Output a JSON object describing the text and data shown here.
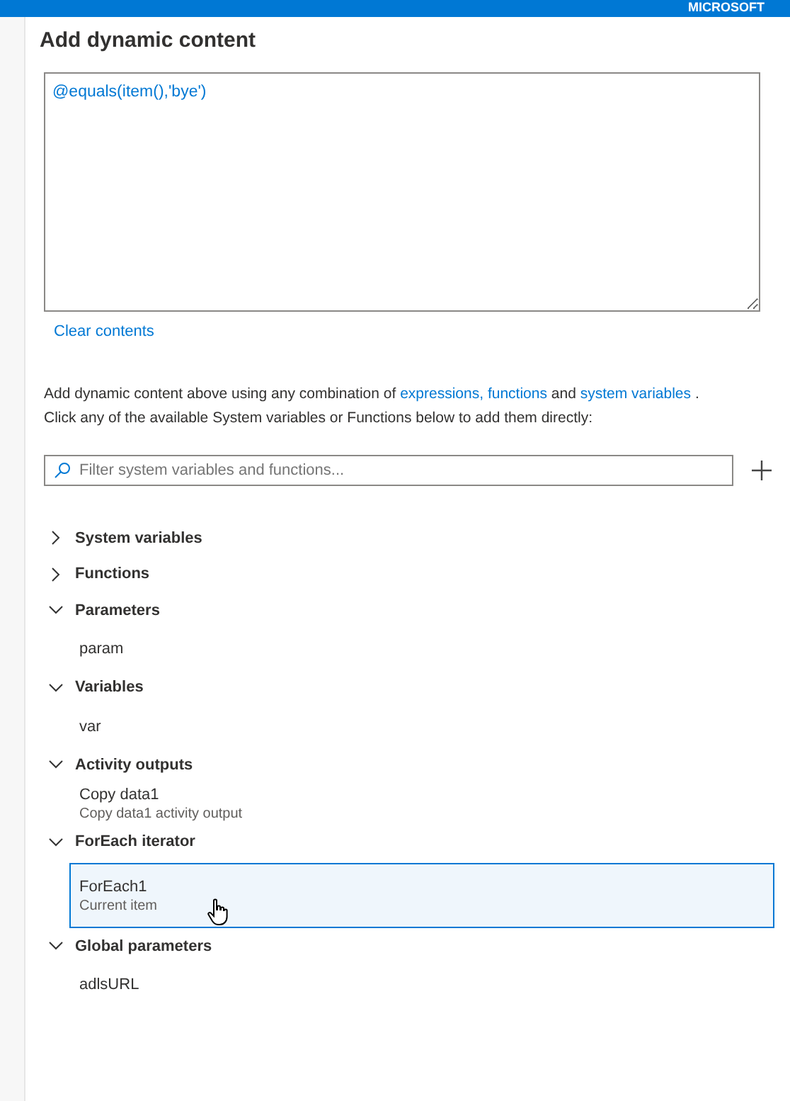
{
  "top_bar": {
    "account": "MICROSOFT"
  },
  "panel": {
    "title": "Add dynamic content",
    "expression": "@equals(item(),'bye')",
    "clear_link": "Clear contents",
    "description": {
      "intro": "Add dynamic content above using any combination of",
      "link_1": "expressions, functions",
      "joiner": "and",
      "link_2": "system variables",
      "end": ".",
      "line_2": "Click any of the available System variables or Functions below to add them directly:"
    },
    "filter": {
      "placeholder": "Filter system variables and functions..."
    },
    "groups": [
      {
        "label": "System variables",
        "expanded": false
      },
      {
        "label": "Functions",
        "expanded": false
      },
      {
        "label": "Parameters",
        "expanded": true,
        "children": [
          {
            "name": "param",
            "selected": false
          }
        ]
      },
      {
        "label": "Variables",
        "expanded": true,
        "children": [
          {
            "name": "var",
            "selected": false
          }
        ]
      },
      {
        "label": "Activity outputs",
        "expanded": true,
        "children": [
          {
            "name": "Copy data1",
            "subtitle": "Copy data1 activity output",
            "selected": false
          }
        ]
      },
      {
        "label": "ForEach iterator",
        "expanded": true,
        "children": [
          {
            "name": "ForEach1",
            "subtitle": "Current item",
            "selected": true
          }
        ]
      },
      {
        "label": "Global parameters",
        "expanded": true,
        "children": [
          {
            "name": "adlsURL",
            "selected": false
          }
        ]
      }
    ]
  }
}
